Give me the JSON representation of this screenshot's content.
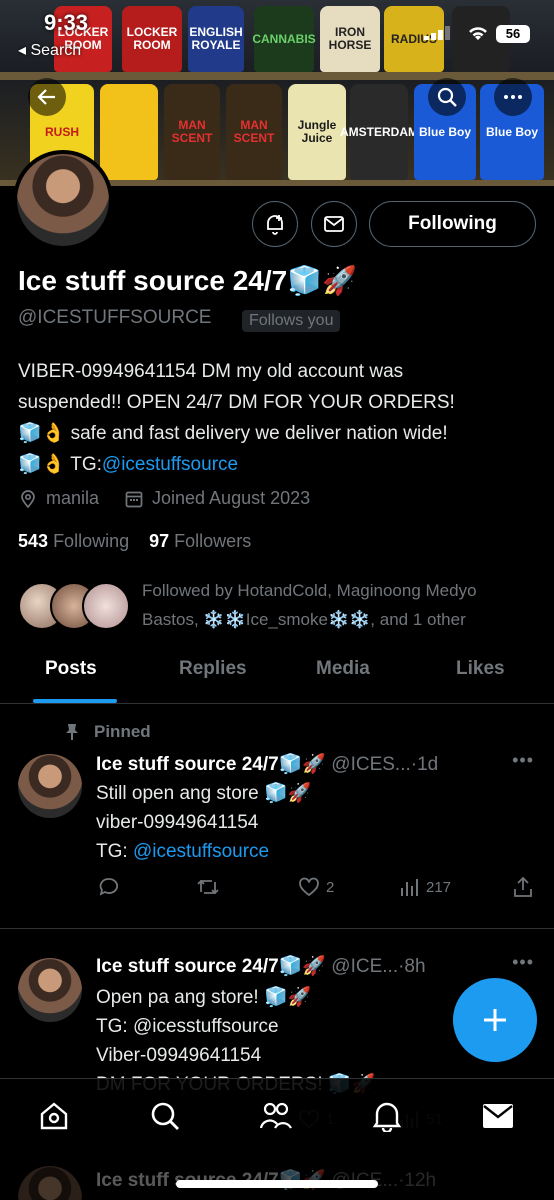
{
  "status_bar": {
    "time": "9:33",
    "back_label": "◂ Search",
    "battery": "56"
  },
  "banner": {
    "bottles": [
      "LOCKER ROOM",
      "LOCKER ROOM",
      "ENGLISH ROYALE",
      "CANNABIS",
      "IRON HORSE",
      "RADIUS",
      "",
      "RUSH",
      "MAN SCENT",
      "MAN SCENT",
      "Jungle Juice",
      "AMSTERDAM",
      "Blue Boy",
      "Blue Boy"
    ]
  },
  "profile": {
    "name": "Ice stuff source 24/7🧊🚀",
    "handle": "@ICESTUFFSOURCE",
    "follows_you": "Follows you",
    "follow_button": "Following",
    "bio_lines": [
      "VIBER-09949641154 DM my old account was",
      "suspended!! OPEN 24/7 DM FOR YOUR ORDERS!",
      "🧊👌 safe and fast delivery we deliver nation wide!",
      "🧊👌 TG:"
    ],
    "bio_link": "@icestuffsource",
    "location": "manila",
    "joined": "Joined August 2023",
    "following_count": "543",
    "following_label": "Following",
    "followers_count": "97",
    "followers_label": "Followers",
    "followed_by_line1": "Followed by HotandCold, Maginoong Medyo",
    "followed_by_line2": "Bastos, ❄️❄️Ice_smoke❄️❄️, and 1 other"
  },
  "tabs": [
    "Posts",
    "Replies",
    "Media",
    "Likes"
  ],
  "tweets": [
    {
      "pinned_label": "Pinned",
      "name": "Ice stuff source 24/7🧊🚀",
      "handle": "@ICES...",
      "time": "·1d",
      "lines": [
        "Still open ang store 🧊🚀",
        "viber-09949641154",
        "TG: "
      ],
      "link": "@icestuffsource",
      "likes": "2",
      "views": "217"
    },
    {
      "name": "Ice stuff source 24/7🧊🚀",
      "handle": "@ICE...",
      "time": "·8h",
      "lines": [
        "Open pa ang store! 🧊🚀",
        "TG: @icesstuffsource",
        "Viber-09949641154",
        "DM FOR YOUR ORDERS! 🧊🚀"
      ],
      "likes": "1",
      "views": "51"
    },
    {
      "name": "Ice stuff source 24/7🧊🚀",
      "handle": "@ICE...",
      "time": "·12h"
    }
  ],
  "colors": {
    "accent": "#1d9bf0",
    "muted": "#71767b",
    "divider": "#2f3336"
  }
}
